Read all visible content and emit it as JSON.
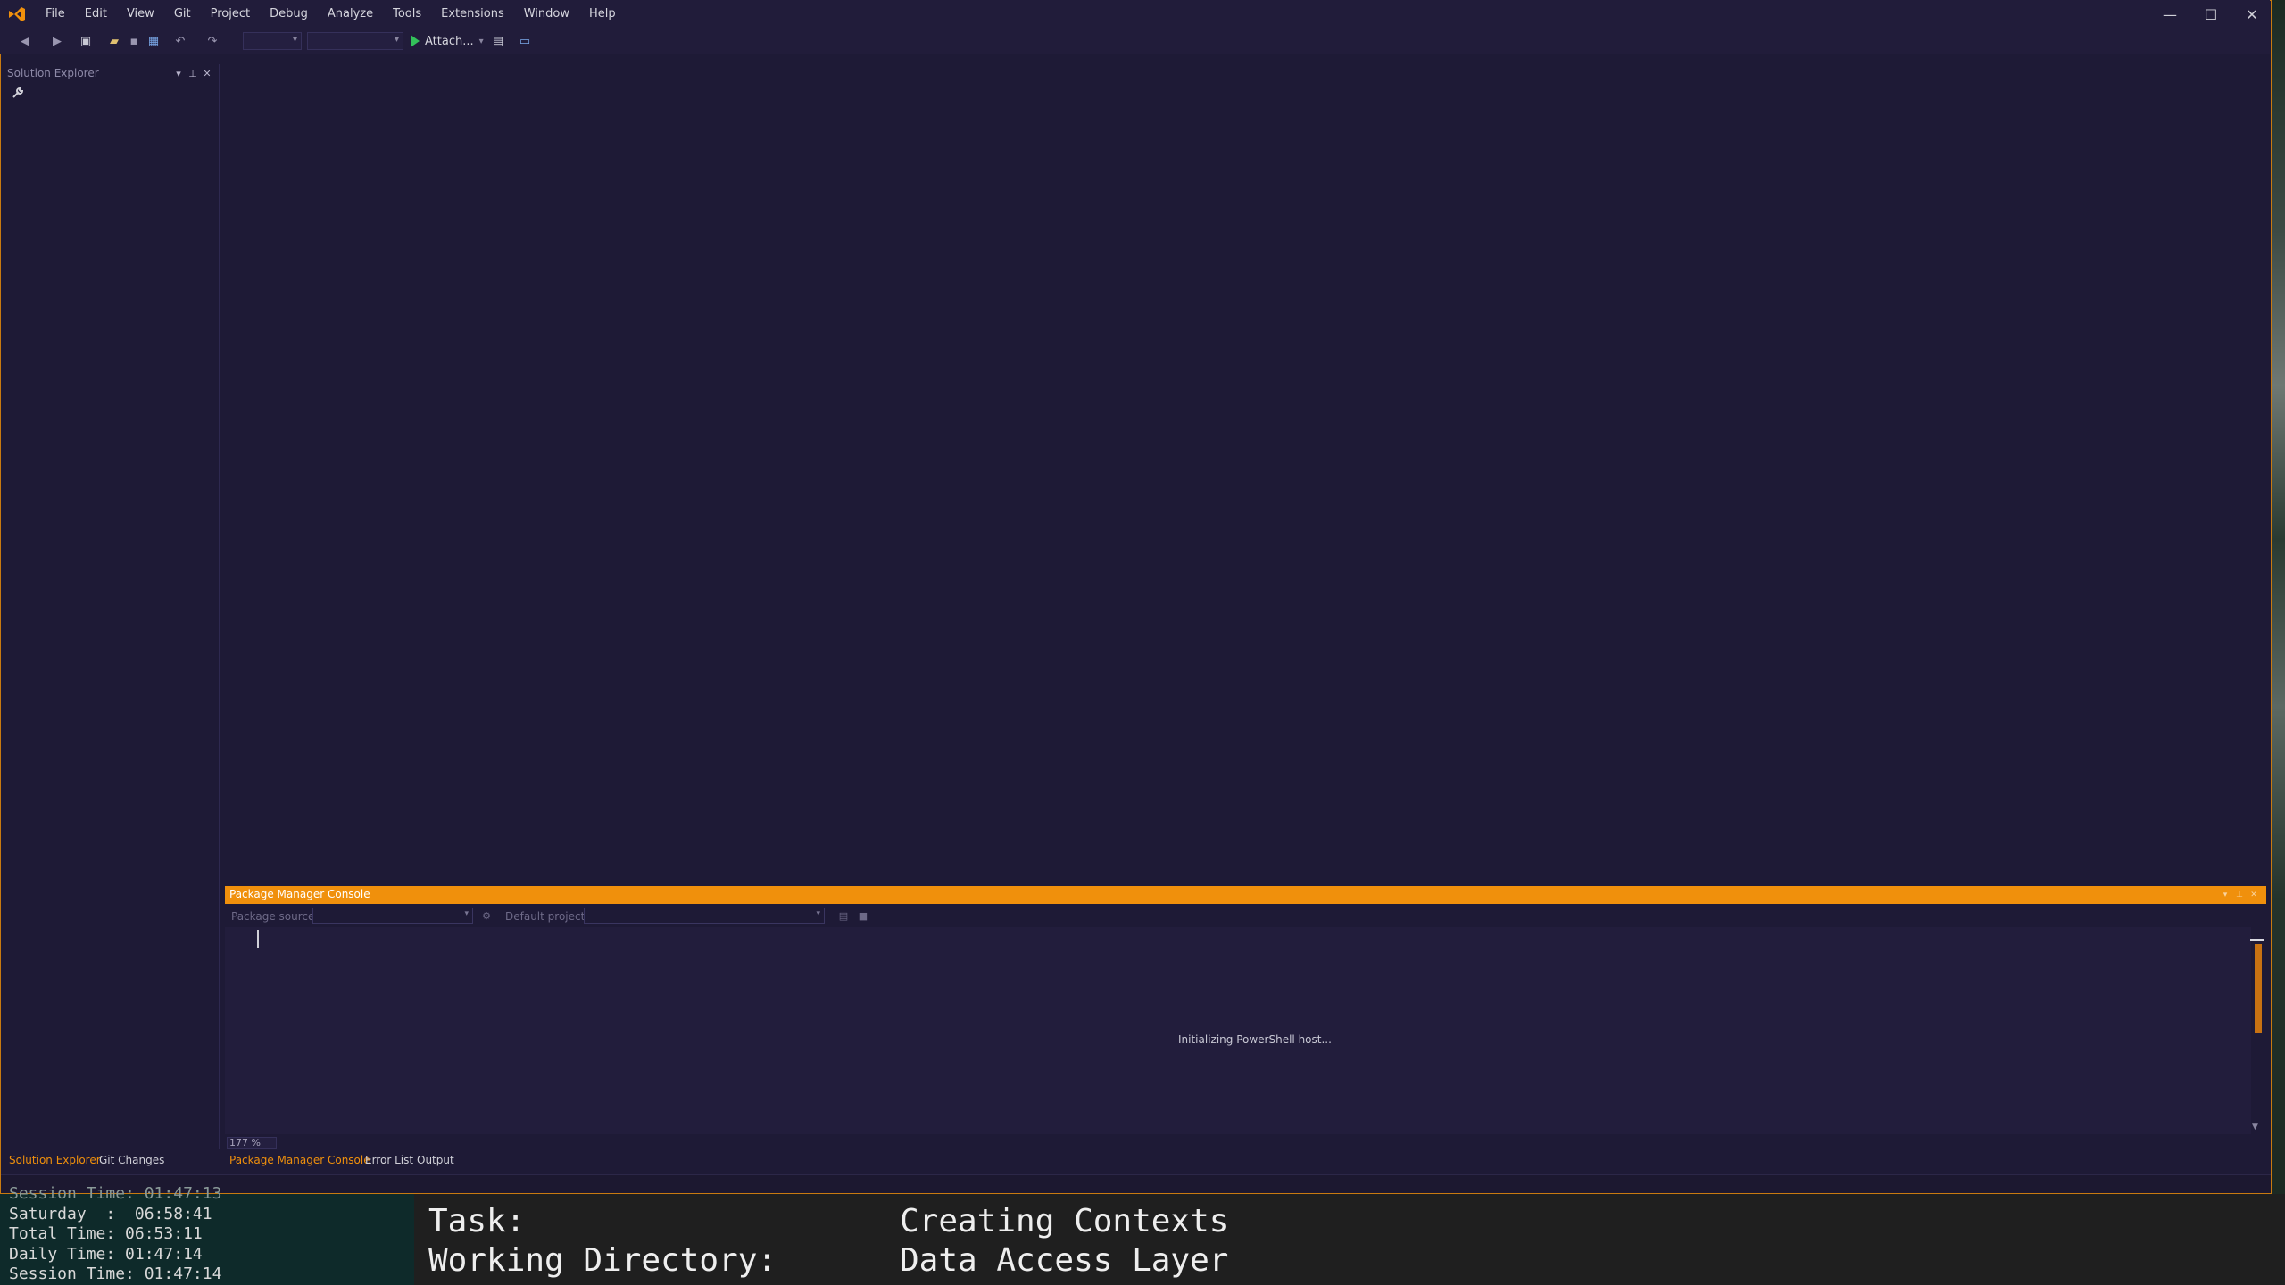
{
  "app": {
    "menu": [
      "File",
      "Edit",
      "View",
      "Git",
      "Project",
      "Debug",
      "Analyze",
      "Tools",
      "Extensions",
      "Window",
      "Help"
    ],
    "window_controls": {
      "minimize": "—",
      "maximize": "☐",
      "close": "✕"
    }
  },
  "toolbar": {
    "attach_label": "Attach...",
    "attach_dropdown": "▾"
  },
  "solution_explorer": {
    "title": "Solution Explorer"
  },
  "pmc": {
    "title": "Package Manager Console",
    "package_source_label": "Package source:",
    "default_project_label": "Default project:",
    "status_text": "Initializing PowerShell host...",
    "zoom": "177 %"
  },
  "left_tabs": [
    {
      "label": "Solution Explorer",
      "active": true
    },
    {
      "label": "Git Changes",
      "active": false
    }
  ],
  "bottom_tabs": [
    {
      "label": "Package Manager Console",
      "active": true
    },
    {
      "label": "Error List",
      "active": false
    },
    {
      "label": "Output",
      "active": false
    }
  ],
  "timer": {
    "line0": "Session Time: 01:47:13",
    "line1": "Saturday  :  06:58:41",
    "line2": "Total Time: 06:53:11",
    "line3": "Daily Time: 01:47:14",
    "line4": "Session Time: 01:47:14"
  },
  "task_panel": {
    "task_label": "Task:",
    "task_value": "Creating Contexts",
    "dir_label": "Working Directory:",
    "dir_value": "Data Access Layer"
  },
  "colors": {
    "accent": "#f0900c",
    "background": "#1e1a36",
    "run_green": "#33c15a"
  }
}
